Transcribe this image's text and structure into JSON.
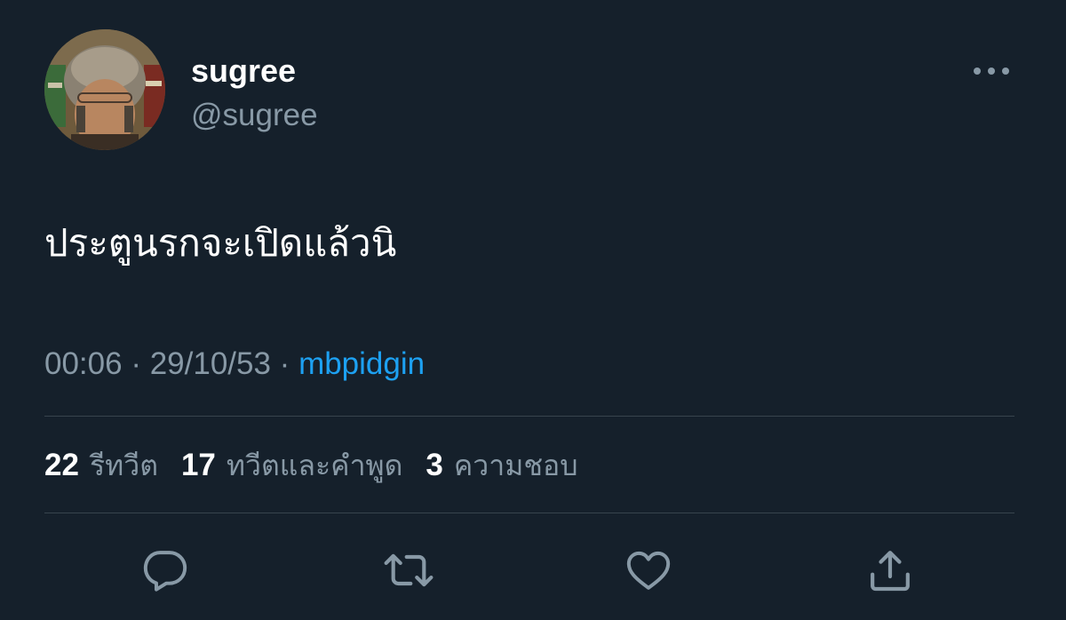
{
  "author": {
    "display_name": "sugree",
    "handle": "@sugree"
  },
  "tweet": {
    "text": "ประตูนรกจะเปิดแล้วนิ"
  },
  "meta": {
    "time": "00:06",
    "sep1": " · ",
    "date": "29/10/53",
    "sep2": " · ",
    "source": "mbpidgin"
  },
  "stats": {
    "retweets_count": "22",
    "retweets_label": "รีทวีต",
    "quotes_count": "17",
    "quotes_label": "ทวีตและคำพูด",
    "likes_count": "3",
    "likes_label": "ความชอบ"
  },
  "icons": {
    "reply": "reply-icon",
    "retweet": "retweet-icon",
    "like": "like-icon",
    "share": "share-icon",
    "more": "more-icon"
  },
  "colors": {
    "background": "#15202b",
    "secondary_text": "#8899a6",
    "link": "#1da1f2",
    "divider": "#38444d"
  }
}
